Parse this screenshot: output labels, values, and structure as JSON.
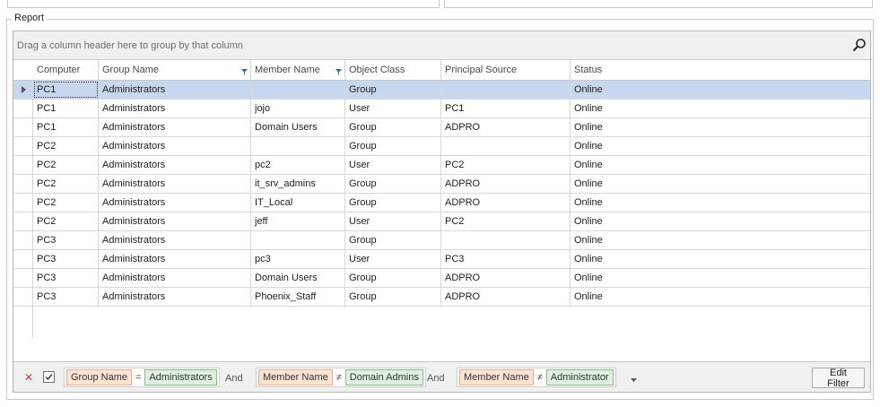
{
  "report": {
    "caption": "Report",
    "group_hint": "Drag a column header here to group by that column",
    "columns": [
      {
        "label": "Computer",
        "filtered": false
      },
      {
        "label": "Group Name",
        "filtered": true
      },
      {
        "label": "Member Name",
        "filtered": true
      },
      {
        "label": "Object Class",
        "filtered": false
      },
      {
        "label": "Principal Source",
        "filtered": false
      },
      {
        "label": "Status",
        "filtered": false
      }
    ],
    "rows": [
      {
        "computer": "PC1",
        "group": "Administrators",
        "member": "",
        "object_class": "Group",
        "source": "",
        "status": "Online",
        "selected": true
      },
      {
        "computer": "PC1",
        "group": "Administrators",
        "member": "jojo",
        "object_class": "User",
        "source": "PC1",
        "status": "Online"
      },
      {
        "computer": "PC1",
        "group": "Administrators",
        "member": "Domain Users",
        "object_class": "Group",
        "source": "ADPRO",
        "status": "Online"
      },
      {
        "computer": "PC2",
        "group": "Administrators",
        "member": "",
        "object_class": "Group",
        "source": "",
        "status": "Online"
      },
      {
        "computer": "PC2",
        "group": "Administrators",
        "member": "pc2",
        "object_class": "User",
        "source": "PC2",
        "status": "Online"
      },
      {
        "computer": "PC2",
        "group": "Administrators",
        "member": "it_srv_admins",
        "object_class": "Group",
        "source": "ADPRO",
        "status": "Online"
      },
      {
        "computer": "PC2",
        "group": "Administrators",
        "member": "IT_Local",
        "object_class": "Group",
        "source": "ADPRO",
        "status": "Online"
      },
      {
        "computer": "PC2",
        "group": "Administrators",
        "member": "jeff",
        "object_class": "User",
        "source": "PC2",
        "status": "Online"
      },
      {
        "computer": "PC3",
        "group": "Administrators",
        "member": "",
        "object_class": "Group",
        "source": "",
        "status": "Online"
      },
      {
        "computer": "PC3",
        "group": "Administrators",
        "member": "pc3",
        "object_class": "User",
        "source": "PC3",
        "status": "Online"
      },
      {
        "computer": "PC3",
        "group": "Administrators",
        "member": "Domain Users",
        "object_class": "Group",
        "source": "ADPRO",
        "status": "Online"
      },
      {
        "computer": "PC3",
        "group": "Administrators",
        "member": "Phoenix_Staff",
        "object_class": "Group",
        "source": "ADPRO",
        "status": "Online"
      }
    ]
  },
  "filter": {
    "enabled": true,
    "conditions": [
      {
        "field": "Group Name",
        "operator": "=",
        "value": "Administrators"
      },
      {
        "field": "Member Name",
        "operator": "≠",
        "value": "Domain Admins"
      },
      {
        "field": "Member Name",
        "operator": "≠",
        "value": "Administrator"
      }
    ],
    "join_label": "And",
    "edit_label": "Edit Filter"
  },
  "colors": {
    "selected_row": "#c7d8ee",
    "field_token": "#fbe3d6",
    "value_token": "#dff0df",
    "remove_filter": "#d9363e"
  }
}
